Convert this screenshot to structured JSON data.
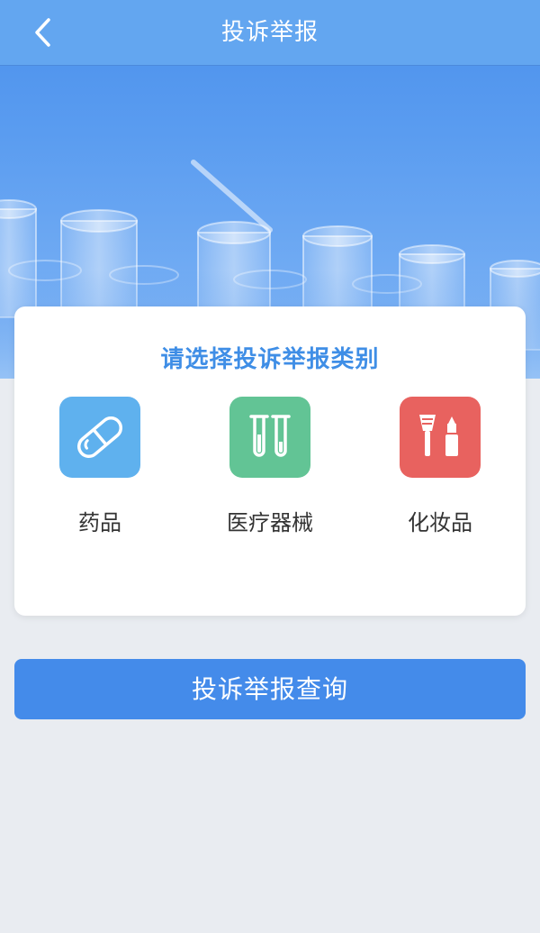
{
  "header": {
    "title": "投诉举报",
    "back_icon": "chevron-left-icon"
  },
  "card": {
    "title": "请选择投诉举报类别",
    "categories": [
      {
        "label": "药品",
        "icon": "capsule-icon",
        "color": "#5fb1ee"
      },
      {
        "label": "医疗器械",
        "icon": "test-tubes-icon",
        "color": "#62c495"
      },
      {
        "label": "化妆品",
        "icon": "makeup-brush-lipstick-icon",
        "color": "#e8625f"
      }
    ]
  },
  "query_button": {
    "label": "投诉举报查询"
  },
  "colors": {
    "nav_bar": "#63a6f0",
    "accent": "#448bea",
    "title_text": "#3f8ee6",
    "page_bg": "#e9ecf1"
  }
}
